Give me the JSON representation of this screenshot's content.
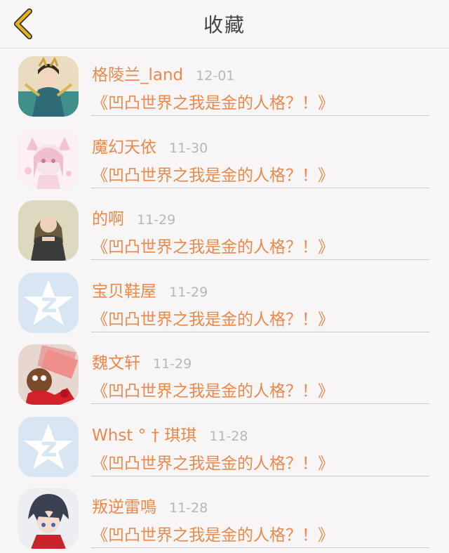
{
  "header": {
    "title": "收藏",
    "back_icon": "chevron-left-icon",
    "accent": "#e8b21c"
  },
  "colors": {
    "name": "#e9894b",
    "date": "#b9b6b8"
  },
  "items": [
    {
      "name": "格陵兰_land",
      "date": "12-01",
      "book": "《凹凸世界之我是金的人格？！》",
      "avatar": "anime-warrior-avatar"
    },
    {
      "name": "魔幻天依",
      "date": "11-30",
      "book": "《凹凸世界之我是金的人格？！》",
      "avatar": "pink-cat-girl-avatar"
    },
    {
      "name": "的啊",
      "date": "11-29",
      "book": "《凹凸世界之我是金的人格？！》",
      "avatar": "photo-girl-avatar"
    },
    {
      "name": "宝贝鞋屋",
      "date": "11-29",
      "book": "《凹凸世界之我是金的人格？！》",
      "avatar": "qq-default-avatar"
    },
    {
      "name": "魏文轩",
      "date": "11-29",
      "book": "《凹凸世界之我是金的人格？！》",
      "avatar": "money-cartoon-avatar"
    },
    {
      "name": "Whst ° † 琪琪",
      "date": "11-28",
      "book": "《凹凸世界之我是金的人格？！》",
      "avatar": "qq-default-avatar"
    },
    {
      "name": "叛逆雷鳴",
      "date": "11-28",
      "book": "《凹凸世界之我是金的人格？！》",
      "avatar": "anime-boy-avatar"
    }
  ]
}
